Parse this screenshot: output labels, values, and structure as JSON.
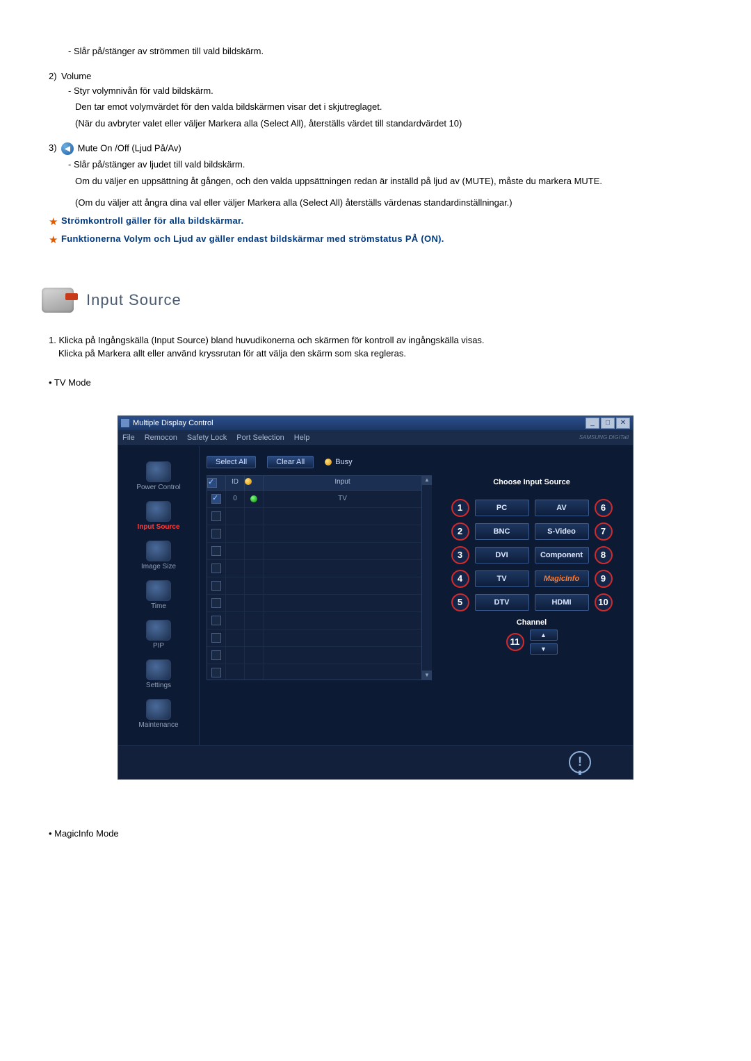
{
  "top": {
    "power_desc": "Slår på/stänger av strömmen till vald bildskärm.",
    "item2_num": "2)",
    "item2_title": "Volume",
    "item2_l1": "Styr volymnivån för vald bildskärm.",
    "item2_l2": "Den tar emot volymvärdet för den valda bildskärmen visar det i skjutreglaget.",
    "item2_l3": "(När du avbryter valet eller väljer Markera alla (Select All), återställs värdet till standardvärdet 10)",
    "item3_num": "3)",
    "item3_title": "Mute On /Off (Ljud På/Av)",
    "item3_l1": "Slår på/stänger av ljudet till vald bildskärm.",
    "item3_l2": "Om du väljer en uppsättning åt gången, och den valda uppsättningen redan är inställd på ljud av (MUTE), måste du markera MUTE.",
    "item3_l3": "(Om du väljer att ångra dina val eller väljer Markera alla (Select All) återställs värdenas standardinställningar.)",
    "star1": "Strömkontroll gäller för alla bildskärmar.",
    "star2": "Funktionerna Volym och Ljud av gäller endast bildskärmar med strömstatus PÅ (ON)."
  },
  "section": {
    "title": "Input Source",
    "p1_num": "1.",
    "p1_l1": "Klicka på Ingångskälla (Input Source) bland huvudikonerna och skärmen för kontroll av ingångskälla visas.",
    "p1_l2": "Klicka på Markera allt eller använd kryssrutan för att välja den skärm som ska regleras.",
    "bullet1": "• TV Mode",
    "bullet2": "• MagicInfo Mode"
  },
  "app": {
    "title": "Multiple Display Control",
    "menu": {
      "file": "File",
      "remocon": "Remocon",
      "safety": "Safety Lock",
      "port": "Port Selection",
      "help": "Help"
    },
    "logo": "SAMSUNG DIGITall",
    "sidebar": {
      "power": "Power Control",
      "input": "Input Source",
      "image": "Image Size",
      "time": "Time",
      "pip": "PIP",
      "settings": "Settings",
      "maintenance": "Maintenance"
    },
    "toolbar": {
      "select_all": "Select All",
      "clear_all": "Clear All",
      "busy": "Busy"
    },
    "grid": {
      "h_chk": "✓",
      "h_id": "ID",
      "h_status": "",
      "h_input": "Input",
      "row0_id": "0",
      "row0_input": "TV"
    },
    "panel": {
      "title": "Choose Input Source",
      "pc": "PC",
      "av": "AV",
      "bnc": "BNC",
      "svideo": "S-Video",
      "dvi": "DVI",
      "component": "Component",
      "tv": "TV",
      "magic": "MagicInfo",
      "dtv": "DTV",
      "hdmi": "HDMI",
      "channel": "Channel",
      "n1": "1",
      "n2": "2",
      "n3": "3",
      "n4": "4",
      "n5": "5",
      "n6": "6",
      "n7": "7",
      "n8": "8",
      "n9": "9",
      "n10": "10",
      "n11": "11"
    }
  }
}
